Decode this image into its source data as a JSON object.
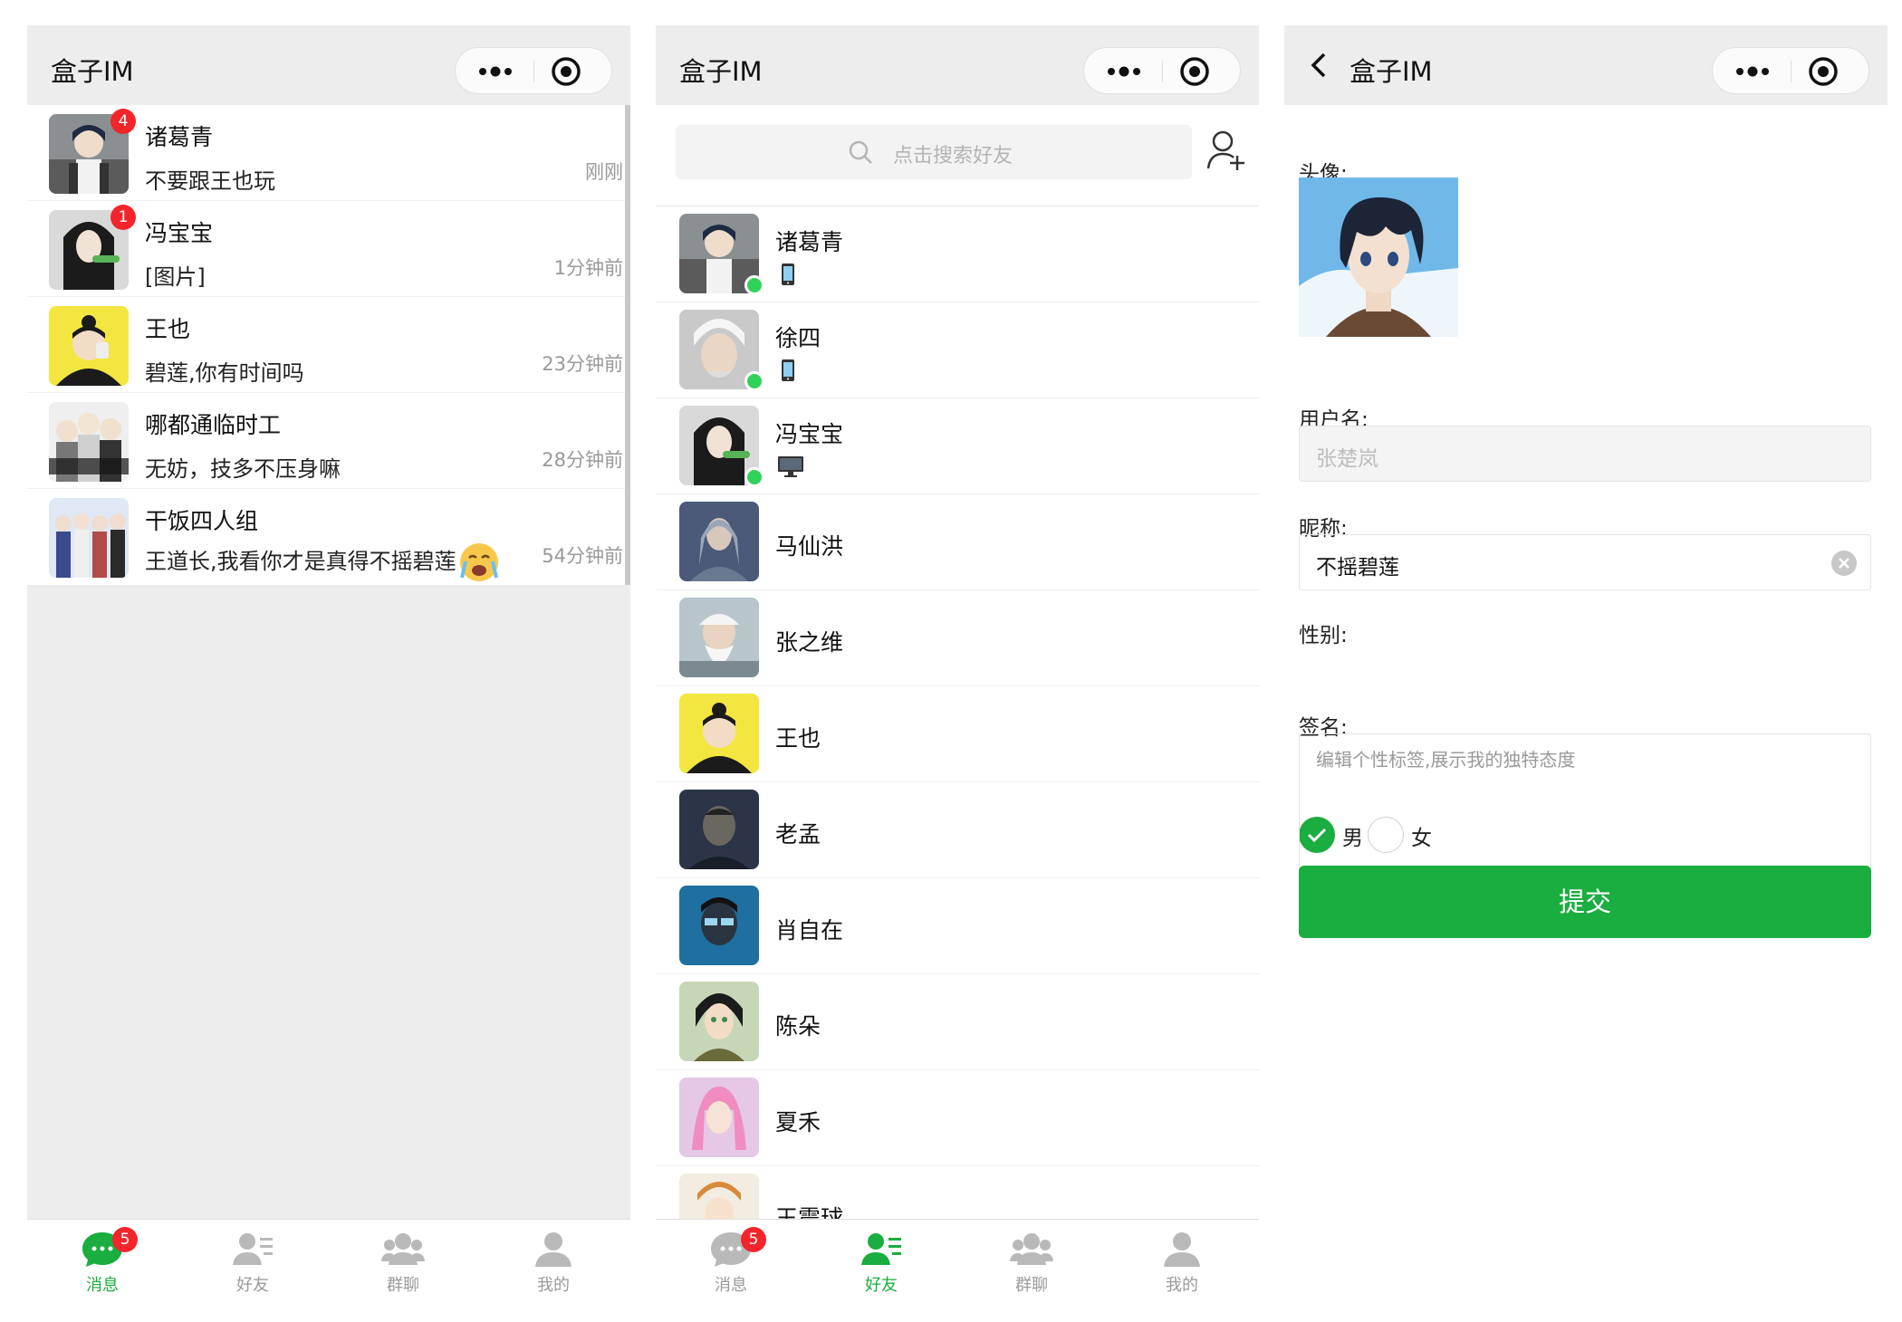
{
  "app_title": "盒子IM",
  "tabs": [
    {
      "label": "消息",
      "icon": "chat-icon"
    },
    {
      "label": "好友",
      "icon": "friends-icon"
    },
    {
      "label": "群聊",
      "icon": "group-icon"
    },
    {
      "label": "我的",
      "icon": "user-icon"
    }
  ],
  "unread_total": "5",
  "accent_color": "#1aad3f",
  "chats": [
    {
      "name": "诸葛青",
      "message": "不要跟王也玩",
      "time": "刚刚",
      "badge": "4"
    },
    {
      "name": "冯宝宝",
      "message": "[图片]",
      "time": "1分钟前",
      "badge": "1"
    },
    {
      "name": "王也",
      "message": "碧莲,你有时间吗",
      "time": "23分钟前",
      "badge": ""
    },
    {
      "name": "哪都通临时工",
      "message": "无妨，技多不压身嘛",
      "time": "28分钟前",
      "badge": ""
    },
    {
      "name": "干饭四人组",
      "message": "王道长,我看你才是真得不摇碧莲",
      "time": "54分钟前",
      "badge": ""
    }
  ],
  "friends_search_placeholder": "点击搜索好友",
  "friends": [
    {
      "name": "诸葛青",
      "online": true,
      "device": "phone-icon"
    },
    {
      "name": "徐四",
      "online": true,
      "device": "phone-icon"
    },
    {
      "name": "冯宝宝",
      "online": true,
      "device": "desktop-icon"
    },
    {
      "name": "马仙洪",
      "online": false,
      "device": ""
    },
    {
      "name": "张之维",
      "online": false,
      "device": ""
    },
    {
      "name": "王也",
      "online": false,
      "device": ""
    },
    {
      "name": "老孟",
      "online": false,
      "device": ""
    },
    {
      "name": "肖自在",
      "online": false,
      "device": ""
    },
    {
      "name": "陈朵",
      "online": false,
      "device": ""
    },
    {
      "name": "夏禾",
      "online": false,
      "device": ""
    },
    {
      "name": "王震球",
      "online": false,
      "device": ""
    }
  ],
  "profile": {
    "avatar_label": "头像:",
    "username_label": "用户名:",
    "username_value": "张楚岚",
    "nickname_label": "昵称:",
    "nickname_value": "不摇碧莲",
    "gender_label": "性别:",
    "gender_male": "男",
    "gender_female": "女",
    "gender_selected": "男",
    "signature_label": "签名:",
    "signature_placeholder": "编辑个性标签,展示我的独特态度",
    "submit_label": "提交"
  }
}
